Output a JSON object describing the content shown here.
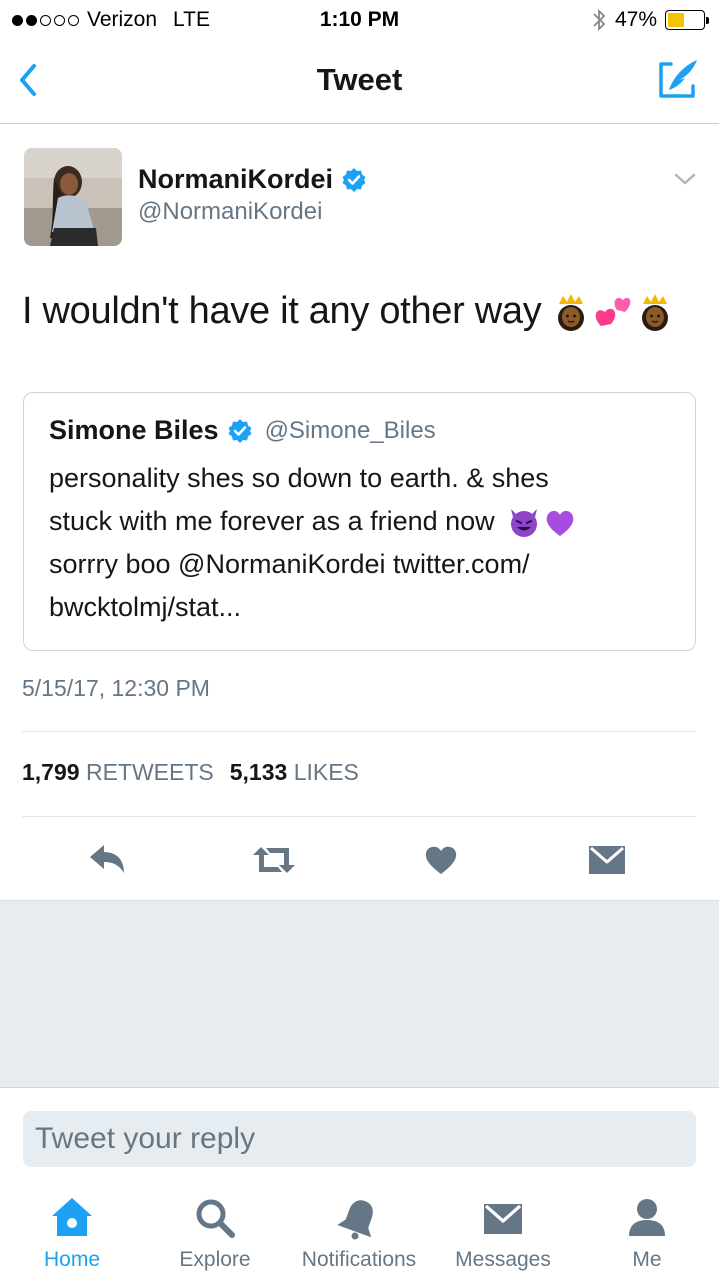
{
  "status_bar": {
    "carrier": "Verizon",
    "network": "LTE",
    "time": "1:10 PM",
    "battery": "47%",
    "battery_level": 0.47
  },
  "nav": {
    "title": "Tweet",
    "back_icon": "chevron-left-icon",
    "compose_icon": "compose-icon"
  },
  "tweet": {
    "author_name": "NormaniKordei",
    "author_handle": "@NormaniKordei",
    "verified": true,
    "text": "I wouldn't have it any other way",
    "emojis": [
      "princess-emoji",
      "two-hearts-emoji",
      "princess-emoji"
    ],
    "timestamp": "5/15/17, 12:30 PM",
    "retweets_count": "1,799",
    "retweets_label": "RETWEETS",
    "likes_count": "5,133",
    "likes_label": "LIKES"
  },
  "quote": {
    "author_name": "Simone Biles",
    "author_handle": "@Simone_Biles",
    "verified": true,
    "line1": "personality  shes so down to earth. & shes",
    "line2": "stuck with me forever as a friend now",
    "line2_emojis": [
      "smiling-devil-emoji",
      "purple-heart-emoji"
    ],
    "line3": "sorrry boo  @NormaniKordei twitter.com/",
    "line4": "bwcktolmj/stat..."
  },
  "reply": {
    "placeholder": "Tweet your reply"
  },
  "tabs": [
    {
      "label": "Home",
      "icon": "home-icon",
      "active": true
    },
    {
      "label": "Explore",
      "icon": "search-icon",
      "active": false
    },
    {
      "label": "Notifications",
      "icon": "bell-icon",
      "active": false
    },
    {
      "label": "Messages",
      "icon": "envelope-icon",
      "active": false
    },
    {
      "label": "Me",
      "icon": "person-icon",
      "active": false
    }
  ],
  "colors": {
    "accent": "#1da1f2",
    "secondary_text": "#657786",
    "action_icon": "#657786",
    "battery": "#f5c400"
  }
}
